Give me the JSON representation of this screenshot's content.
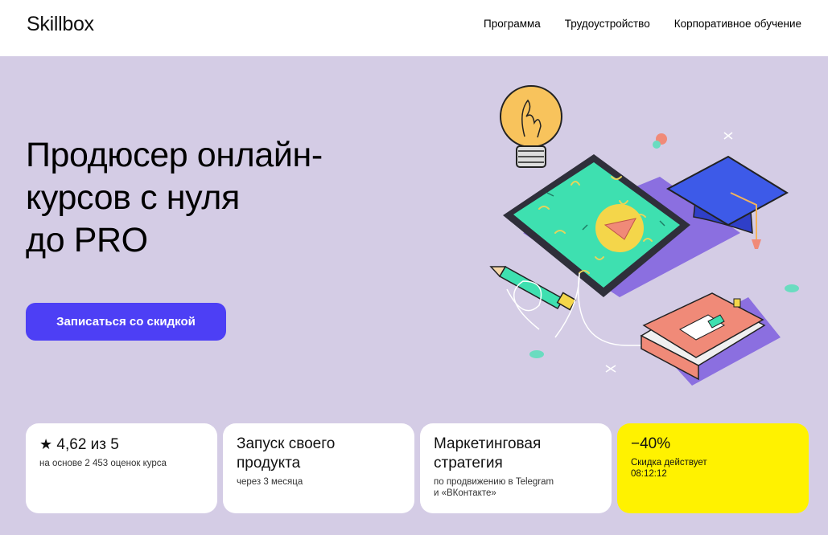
{
  "header": {
    "logo": "Skillbox",
    "nav": [
      "Программа",
      "Трудоустройство",
      "Корпоративное обучение"
    ]
  },
  "hero": {
    "title_line1": "Продюсер онлайн-",
    "title_line2": "курсов с нуля",
    "title_line3": "до PRO",
    "cta_label": "Записаться со скидкой"
  },
  "cards": {
    "rating": {
      "title": "4,62 из 5",
      "sub": "на основе 2 453 оценок курса",
      "icon": "star-icon"
    },
    "launch": {
      "title_line1": "Запуск своего",
      "title_line2": "продукта",
      "sub": "через 3 месяца"
    },
    "marketing": {
      "title_line1": "Маркетинговая",
      "title_line2": "стратегия",
      "sub_line1": "по продвижению в Telegram",
      "sub_line2": "и «ВКонтакте»"
    },
    "discount": {
      "title": "−40%",
      "sub_line1": "Скидка действует",
      "sub_line2": "08:12:12"
    }
  },
  "colors": {
    "background": "#d4cce5",
    "accent": "#4d3ff5",
    "discount_card": "#fff200"
  }
}
